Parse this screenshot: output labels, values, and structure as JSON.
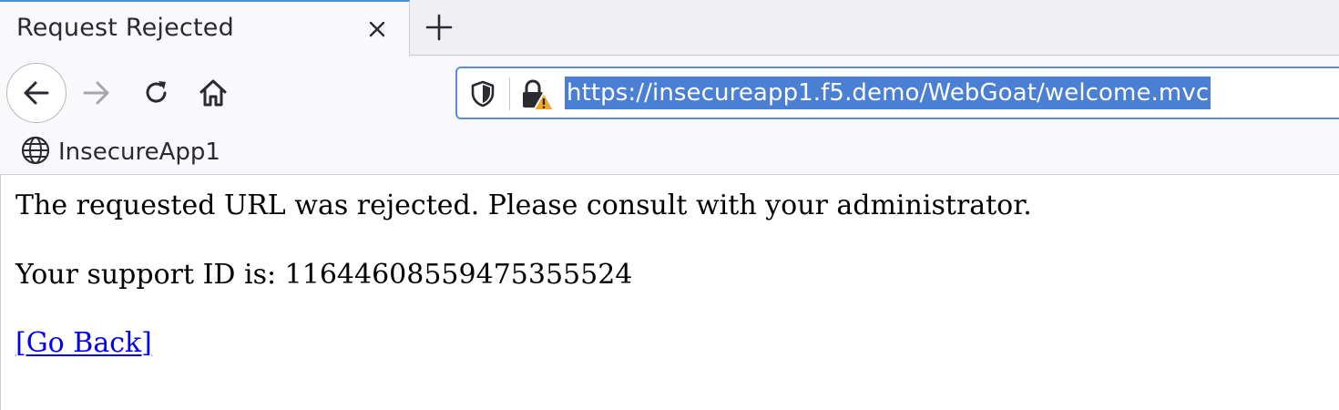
{
  "tabs": [
    {
      "title": "Request Rejected",
      "active": true
    }
  ],
  "toolbar": {
    "url": "https://insecureapp1.f5.demo/WebGoat/welcome.mvc",
    "icons": [
      "back-icon",
      "forward-icon",
      "reload-icon",
      "home-icon",
      "tracking-shield-icon",
      "insecure-lock-warning-icon"
    ]
  },
  "bookmarks": [
    {
      "label": "InsecureApp1",
      "icon": "globe-icon"
    }
  ],
  "page": {
    "message": "The requested URL was rejected. Please consult with your administrator.",
    "support_text": "Your support ID is: 11644608559475355524",
    "go_back_label": "[Go Back]"
  },
  "colors": {
    "link": "#0000ee",
    "selection": "#4a7fd4",
    "warning": "#f5a623",
    "url_focus_border": "#5a8fd8"
  }
}
